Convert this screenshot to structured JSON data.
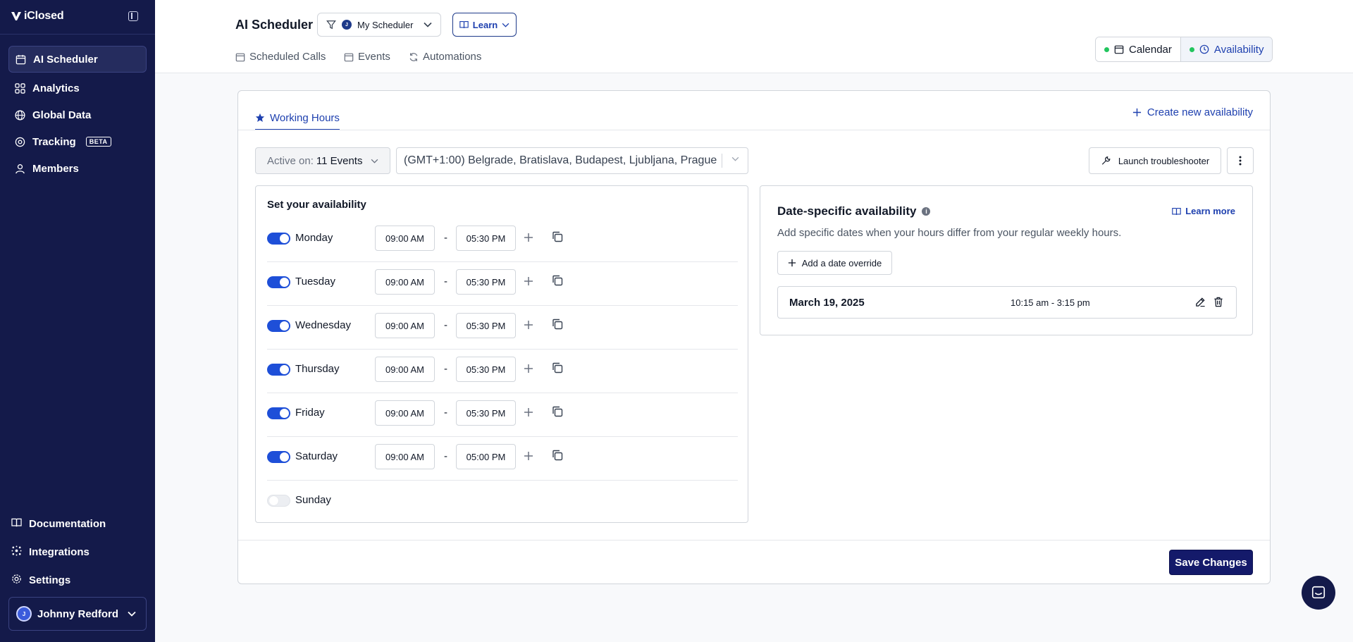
{
  "app": {
    "logo_text": "iClosed"
  },
  "sidebar": {
    "items": [
      {
        "label": "AI Scheduler",
        "icon": "calendar-icon",
        "active": true
      },
      {
        "label": "Analytics",
        "icon": "grid-icon"
      },
      {
        "label": "Global Data",
        "icon": "globe-icon"
      },
      {
        "label": "Tracking",
        "icon": "target-icon",
        "badge": "BETA"
      },
      {
        "label": "Members",
        "icon": "users-icon"
      }
    ],
    "bottom_items": [
      {
        "label": "Documentation",
        "icon": "book-icon"
      },
      {
        "label": "Integrations",
        "icon": "integrations-icon"
      },
      {
        "label": "Settings",
        "icon": "gear-icon"
      }
    ],
    "user": {
      "initial": "J",
      "name": "Johnny Redford"
    }
  },
  "header": {
    "title": "AI Scheduler",
    "scheduler_initial": "J",
    "scheduler_label": "My Scheduler",
    "learn_label": "Learn",
    "tabs": [
      "Scheduled Calls",
      "Events",
      "Automations"
    ],
    "view_toggle": {
      "calendar": "Calendar",
      "availability": "Availability"
    }
  },
  "card": {
    "tab_label": "Working Hours",
    "create_label": "Create new availability",
    "active_on_prefix": "Active on:",
    "active_on_value": "11 Events",
    "timezone": "(GMT+1:00) Belgrade, Bratislava, Budapest, Ljubljana, Prague",
    "troubleshooter_label": "Launch troubleshooter",
    "availability_title": "Set your availability",
    "days": [
      {
        "day": "Monday",
        "enabled": true,
        "start": "09:00 AM",
        "end": "05:30 PM"
      },
      {
        "day": "Tuesday",
        "enabled": true,
        "start": "09:00 AM",
        "end": "05:30 PM"
      },
      {
        "day": "Wednesday",
        "enabled": true,
        "start": "09:00 AM",
        "end": "05:30 PM"
      },
      {
        "day": "Thursday",
        "enabled": true,
        "start": "09:00 AM",
        "end": "05:30 PM"
      },
      {
        "day": "Friday",
        "enabled": true,
        "start": "09:00 AM",
        "end": "05:30 PM"
      },
      {
        "day": "Saturday",
        "enabled": true,
        "start": "09:00 AM",
        "end": "05:00 PM"
      },
      {
        "day": "Sunday",
        "enabled": false
      }
    ],
    "time_separator": "-",
    "date_specific": {
      "title": "Date-specific availability",
      "info": "i",
      "learn_more": "Learn more",
      "subtitle": "Add specific dates when your hours differ from your regular weekly hours.",
      "add_label": "Add a date override",
      "overrides": [
        {
          "date": "March 19, 2025",
          "time": "10:15 am - 3:15 pm"
        }
      ]
    },
    "save_label": "Save Changes"
  },
  "colors": {
    "sidebar": "#141a4a",
    "accent": "#1e40af",
    "toggle_on": "#1e4fd8",
    "status_dot": "#22c55e"
  }
}
